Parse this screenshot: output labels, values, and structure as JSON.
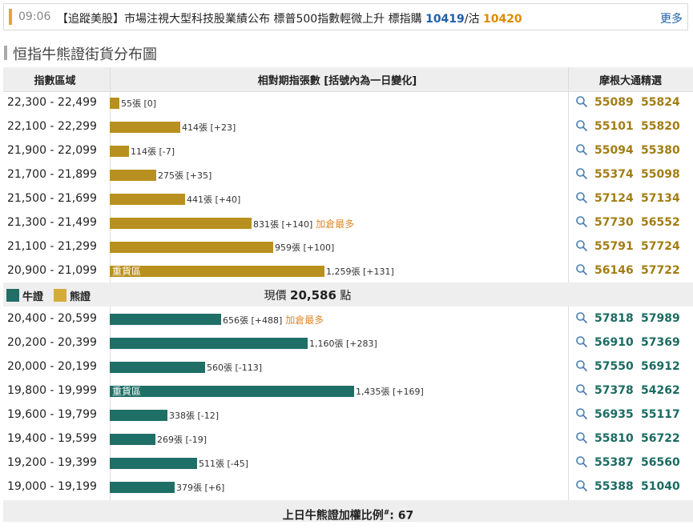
{
  "ticker": {
    "time": "09:06",
    "text": "【追蹤美股】市場注視大型科技股業績公布 標普500指數輕微上升 標指購",
    "value1": "10419",
    "sep": "/沽",
    "value2": "10420",
    "more": "更多"
  },
  "title": "恒指牛熊證街貨分布圖",
  "headers": {
    "range": "指數區域",
    "contracts": "相對期指張數 [括號內為一日變化]",
    "picks": "摩根大通精選"
  },
  "colors": {
    "bear": "#b8901f",
    "bull": "#1f6f66",
    "accent_tag": "#e08a2a",
    "ticker_value1": "#1f5fa8",
    "ticker_value2": "#e08a00"
  },
  "legend": {
    "bull": "牛證",
    "bear": "熊證"
  },
  "current_price": {
    "label": "現價",
    "value": "20,586",
    "unit": "點"
  },
  "footer": {
    "label": "上日牛熊證加權比例",
    "mark": "#",
    "value": ": 67"
  },
  "chart_data": {
    "type": "bar",
    "bear": [
      {
        "range": "22,300 - 22,499",
        "value": 55,
        "label": "55張 [0]",
        "tag": "",
        "inner": "",
        "codes": [
          "55089",
          "55824"
        ]
      },
      {
        "range": "22,100 - 22,299",
        "value": 414,
        "label": "414張 [+23]",
        "tag": "",
        "inner": "",
        "codes": [
          "55101",
          "55820"
        ]
      },
      {
        "range": "21,900 - 22,099",
        "value": 114,
        "label": "114張 [-7]",
        "tag": "",
        "inner": "",
        "codes": [
          "55094",
          "55380"
        ]
      },
      {
        "range": "21,700 - 21,899",
        "value": 275,
        "label": "275張 [+35]",
        "tag": "",
        "inner": "",
        "codes": [
          "55374",
          "55098"
        ]
      },
      {
        "range": "21,500 - 21,699",
        "value": 441,
        "label": "441張 [+40]",
        "tag": "",
        "inner": "",
        "codes": [
          "57124",
          "57134"
        ]
      },
      {
        "range": "21,300 - 21,499",
        "value": 831,
        "label": "831張 [+140]",
        "tag": "加倉最多",
        "inner": "",
        "codes": [
          "57730",
          "56552"
        ]
      },
      {
        "range": "21,100 - 21,299",
        "value": 959,
        "label": "959張 [+100]",
        "tag": "",
        "inner": "",
        "codes": [
          "55791",
          "57724"
        ]
      },
      {
        "range": "20,900 - 21,099",
        "value": 1259,
        "label": "1,259張 [+131]",
        "tag": "",
        "inner": "重貨區",
        "codes": [
          "56146",
          "57722"
        ]
      }
    ],
    "bull": [
      {
        "range": "20,400 - 20,599",
        "value": 656,
        "label": "656張 [+488]",
        "tag": "加倉最多",
        "inner": "",
        "codes": [
          "57818",
          "57989"
        ]
      },
      {
        "range": "20,200 - 20,399",
        "value": 1160,
        "label": "1,160張 [+283]",
        "tag": "",
        "inner": "",
        "codes": [
          "56910",
          "57369"
        ]
      },
      {
        "range": "20,000 - 20,199",
        "value": 560,
        "label": "560張 [-113]",
        "tag": "",
        "inner": "",
        "codes": [
          "57550",
          "56912"
        ]
      },
      {
        "range": "19,800 - 19,999",
        "value": 1435,
        "label": "1,435張 [+169]",
        "tag": "",
        "inner": "重貨區",
        "codes": [
          "57378",
          "54262"
        ]
      },
      {
        "range": "19,600 - 19,799",
        "value": 338,
        "label": "338張 [-12]",
        "tag": "",
        "inner": "",
        "codes": [
          "56935",
          "55117"
        ]
      },
      {
        "range": "19,400 - 19,599",
        "value": 269,
        "label": "269張 [-19]",
        "tag": "",
        "inner": "",
        "codes": [
          "55810",
          "56722"
        ]
      },
      {
        "range": "19,200 - 19,399",
        "value": 511,
        "label": "511張 [-45]",
        "tag": "",
        "inner": "",
        "codes": [
          "55387",
          "56560"
        ]
      },
      {
        "range": "19,000 - 19,199",
        "value": 379,
        "label": "379張 [+6]",
        "tag": "",
        "inner": "",
        "codes": [
          "55388",
          "51040"
        ]
      }
    ]
  }
}
